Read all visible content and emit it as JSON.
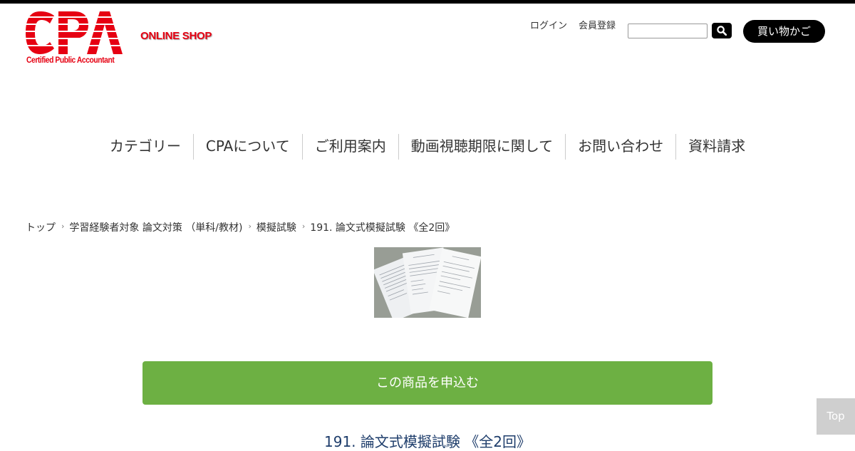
{
  "brand": {
    "logo_text": "CPA",
    "logo_subtitle": "Certified Public Accountant",
    "shop_label": "ONLINE SHOP",
    "brand_color": "#e60012"
  },
  "header": {
    "login_label": "ログイン",
    "register_label": "会員登録",
    "search": {
      "value": "",
      "placeholder": ""
    },
    "search_icon": "search-icon",
    "cart_label": "買い物かご"
  },
  "nav": {
    "items": [
      {
        "label": "カテゴリー"
      },
      {
        "label": "CPAについて"
      },
      {
        "label": "ご利用案内"
      },
      {
        "label": "動画視聴期限に関して"
      },
      {
        "label": "お問い合わせ"
      },
      {
        "label": "資料請求"
      }
    ]
  },
  "breadcrumb": {
    "separator": "›",
    "items": [
      {
        "label": "トップ"
      },
      {
        "label": "学習経験者対象 論文対策 （単科/教材)"
      },
      {
        "label": "模擬試験"
      },
      {
        "label": "191. 論文式模擬試験 《全2回》"
      }
    ]
  },
  "product": {
    "apply_label": "この商品を申込む",
    "apply_color": "#6db043",
    "title": "191. 論文式模擬試験 《全2回》",
    "title_color": "#1e3d6b"
  },
  "scroll_top": {
    "label": "Top"
  }
}
